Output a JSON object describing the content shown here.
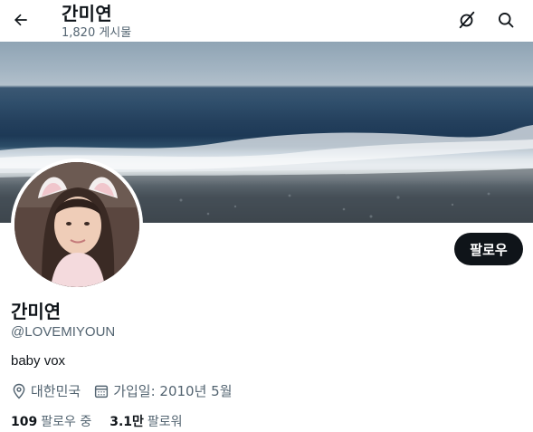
{
  "header": {
    "title": "간미연",
    "post_count": "1,820 게시물",
    "back_icon": "arrow-left-icon",
    "grok_icon": "grok-icon",
    "search_icon": "search-icon"
  },
  "banner": {
    "description_icon": "ocean-beach-banner-image"
  },
  "profile": {
    "avatar_icon": "profile-photo",
    "follow_label": "팔로우",
    "name": "간미연",
    "handle": "@LOVEMIYOUN",
    "bio": "baby vox",
    "location": "대한민국",
    "joined": "가입일: 2010년 5월",
    "following_count": "109",
    "following_label": "팔로우 중",
    "followers_count": "3.1만",
    "followers_label": "팔로워"
  },
  "colors": {
    "text_primary": "#0f1419",
    "text_secondary": "#536471",
    "button_bg": "#0f1419"
  }
}
